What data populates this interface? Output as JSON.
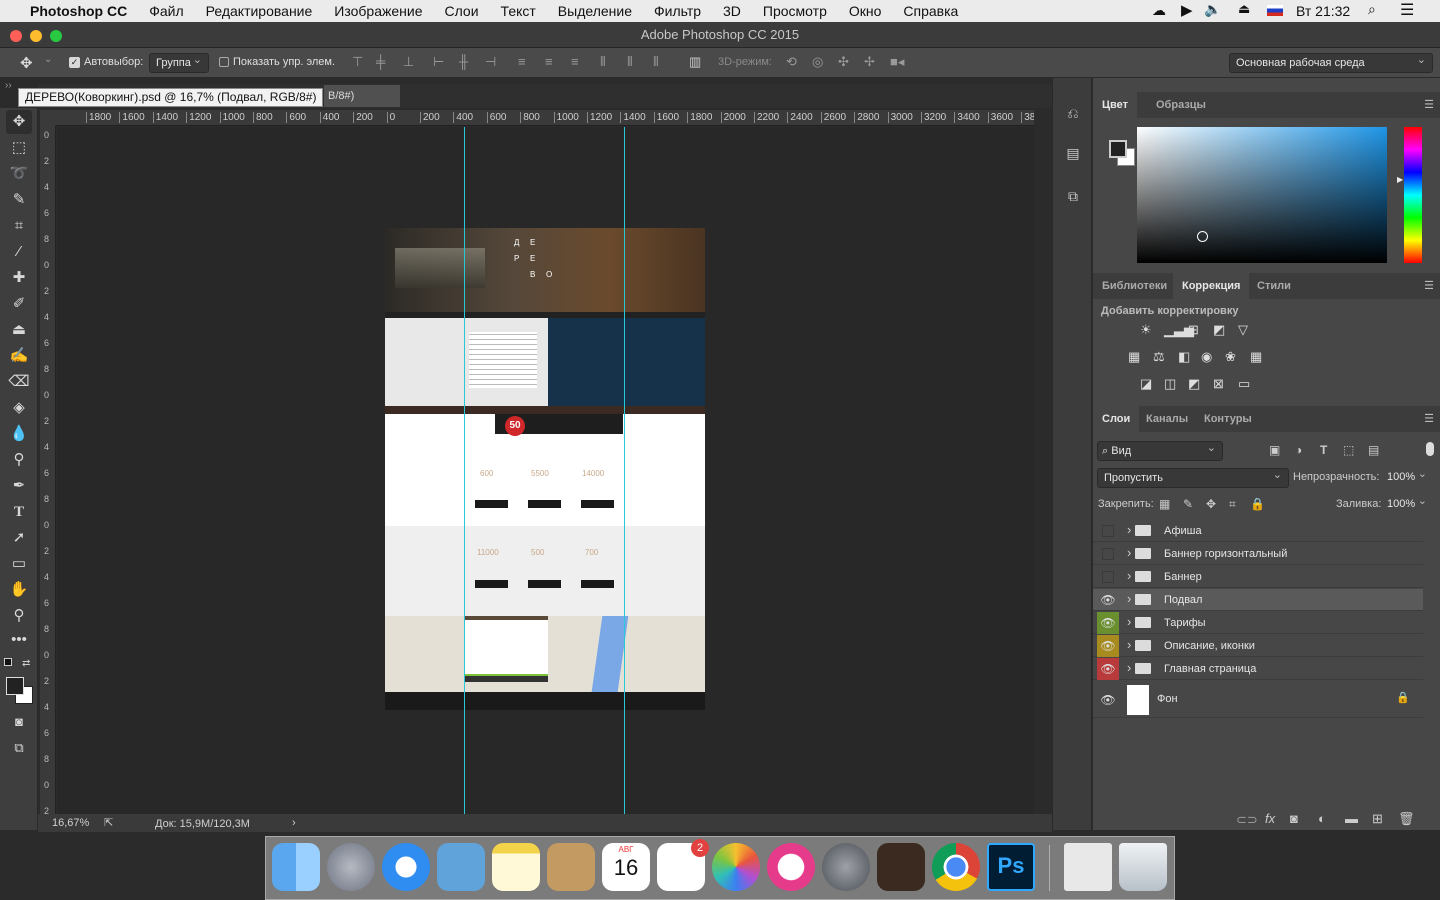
{
  "menubar": {
    "apple": "",
    "app": "Photoshop CC",
    "items": [
      "Файл",
      "Редактирование",
      "Изображение",
      "Слои",
      "Текст",
      "Выделение",
      "Фильтр",
      "3D",
      "Просмотр",
      "Окно",
      "Справка"
    ],
    "clock": "Вт 21:32"
  },
  "window": {
    "title": "Adobe Photoshop CC 2015"
  },
  "options": {
    "autoselect_label": "Автовыбор:",
    "autoselect_value": "Группа",
    "show_transform": "Показать упр. элем.",
    "mode3d": "3D-режим:",
    "workspace": "Основная рабочая среда"
  },
  "document": {
    "tooltip": "ДЕРЕВО(Коворкинг).psd @ 16,7% (Подвал, RGB/8#)",
    "tab_suffix": "B/8#)"
  },
  "ruler_h": [
    "1800",
    "1600",
    "1400",
    "1200",
    "1000",
    "800",
    "600",
    "400",
    "200",
    "0",
    "200",
    "400",
    "600",
    "800",
    "1000",
    "1200",
    "1400",
    "1600",
    "1800",
    "2000",
    "2200",
    "2400",
    "2600",
    "2800",
    "3000",
    "3200",
    "3400",
    "3600",
    "380"
  ],
  "ruler_v": [
    "0",
    "2",
    "4",
    "6",
    "8",
    "0",
    "2",
    "4",
    "6",
    "8",
    "0",
    "2",
    "4",
    "6",
    "8",
    "0",
    "2",
    "4",
    "6",
    "8",
    "0",
    "2",
    "4",
    "6",
    "8",
    "0",
    "2"
  ],
  "status": {
    "zoom": "16,67%",
    "doc": "Док: 15,9М/120,3М"
  },
  "color_panel": {
    "tabs": [
      "Цвет",
      "Образцы"
    ]
  },
  "adj_panel": {
    "tabs": [
      "Библиотеки",
      "Коррекция",
      "Стили"
    ],
    "heading": "Добавить корректировку"
  },
  "layers_panel": {
    "tabs": [
      "Слои",
      "Каналы",
      "Контуры"
    ],
    "filter": "Вид",
    "blend": "Пропустить",
    "opacity_label": "Непрозрачность:",
    "opacity": "100%",
    "lock_label": "Закрепить:",
    "fill_label": "Заливка:",
    "fill": "100%",
    "layers": [
      {
        "name": "Афиша",
        "visible": false,
        "color": ""
      },
      {
        "name": "Баннер горизонтальный",
        "visible": false,
        "color": ""
      },
      {
        "name": "Баннер",
        "visible": false,
        "color": ""
      },
      {
        "name": "Подвал",
        "visible": true,
        "color": "",
        "selected": true
      },
      {
        "name": "Тарифы",
        "visible": true,
        "color": "#6a8f2e"
      },
      {
        "name": "Описание, иконки",
        "visible": true,
        "color": "#a78b1e"
      },
      {
        "name": "Главная страница",
        "visible": true,
        "color": "#b83a3a"
      }
    ],
    "background": "Фон"
  },
  "mockup": {
    "logo": [
      "Д",
      "Е",
      "Р",
      "Е",
      "В",
      "О"
    ],
    "badge": "50",
    "prices1": [
      "600",
      "5500",
      "14000"
    ],
    "prices2": [
      "11000",
      "500",
      "700"
    ]
  },
  "dock": {
    "calendar_month": "АВГ",
    "calendar_day": "16",
    "reminders_badge": "2",
    "ps_label": "Ps"
  }
}
